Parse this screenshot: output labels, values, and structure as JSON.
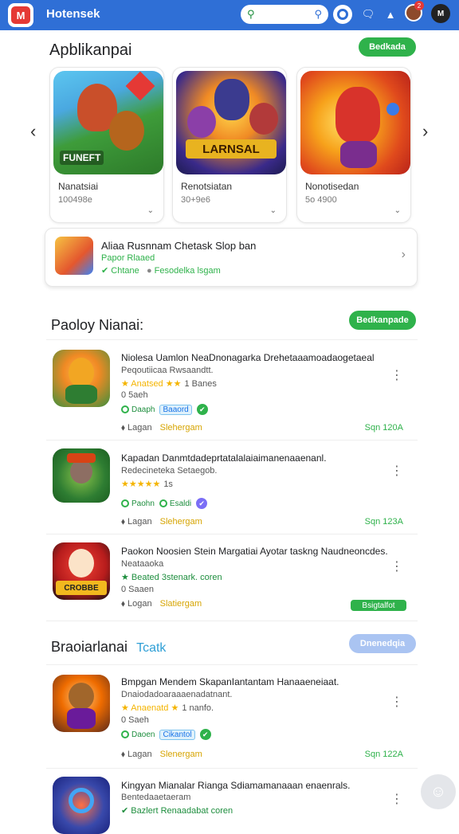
{
  "header": {
    "logo": "M",
    "brand": "Hotensek",
    "search_placeholder": "",
    "notif_count": "2",
    "account": "M"
  },
  "featured": {
    "title": "Apblikanpai",
    "action": "Bedkada",
    "games": [
      {
        "name": "Nanatsiai",
        "sub": "100498e",
        "art": "FUNEFT"
      },
      {
        "name": "Renotsiatan",
        "sub": "30+9e6",
        "art": "LARNSAL"
      },
      {
        "name": "Nonotisedan",
        "sub": "5o 4900",
        "art": ""
      }
    ],
    "promo": {
      "title": "Aliaa Rusnnam Chetask Slop ban",
      "sub": "Papor Rlaaed",
      "meta_a": "Chtane",
      "meta_b": "Fesodelka lsgam"
    }
  },
  "popular": {
    "title": "Paoloy Nianai:",
    "action": "Bedkanpade",
    "items": [
      {
        "name": "Niolesa Uamlon NeaDnonagarka Drehetaaamoadaogetaeal",
        "desc": "Peqoutiicaa Rwsaandtt.",
        "stars": "★ Anatsed ★★",
        "rating": "1 Banes",
        "size": "0 5aeh",
        "chip1": "Daaph",
        "chip2": "Baaord",
        "foot_left": "Lagan",
        "foot_mid": "Slehergam",
        "foot_right": "Sqn 120A"
      },
      {
        "name": "Kapadan Danmtdadeprtatalalaiaimanenaaenanl.",
        "desc": "Redecineteka Setaegob.",
        "stars": "★★★★★",
        "rating": "1s",
        "size": "",
        "chip1": "Paohn",
        "chip2": "Esaldi",
        "foot_left": "Lagan",
        "foot_mid": "Slehergam",
        "foot_right": "Sqn 123A"
      },
      {
        "name": "Paokon Noosien Stein Margatiai Ayotar taskng Naudneoncdes.",
        "desc": "Neataaoka",
        "stars": "★ Beated 3stenark. coren",
        "rating": "",
        "size": "0 Saaen",
        "chip1": "",
        "chip2": "",
        "foot_left": "Logan",
        "foot_mid": "Slatiergam",
        "foot_right": "Bsigtalfot"
      }
    ]
  },
  "third": {
    "title": "Braoiarlanai",
    "tag": "Tcatk",
    "action": "Dnenedqia",
    "items": [
      {
        "name": "Bmpgan Mendem SkapanIantantam Hanaaeneiaat.",
        "desc": "Dnaiodadoaraaaenadatnant.",
        "stars": "★ Anaenatd ★",
        "rating": "1 nanfo.",
        "size": "0 Saeh",
        "chip1": "Daoen",
        "chip2": "Cikantol",
        "foot_left": "Lagan",
        "foot_mid": "Slenergam",
        "foot_right": "Sqn 122A"
      },
      {
        "name": "Kingyan Mianalar Rianga Sdiamamanaaan enaenrals.",
        "desc": "Bentedaaetaeram",
        "stars": "Bazlert Renaadabat coren",
        "rating": "",
        "size": "",
        "chip1": "",
        "chip2": "",
        "foot_left": "",
        "foot_mid": "",
        "foot_right": ""
      }
    ]
  }
}
